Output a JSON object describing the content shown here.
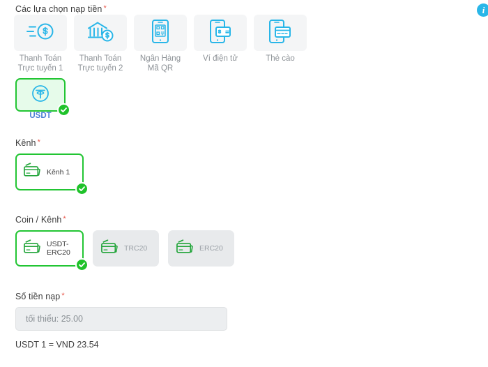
{
  "header": {
    "info_icon": "info-icon",
    "info_label": "i"
  },
  "deposit_options": {
    "heading": "Các lựa chọn nạp tiền",
    "required_mark": "*",
    "items": [
      {
        "label": "Thanh Toán\nTrực tuyến 1",
        "icon": "fast-money-coin-icon"
      },
      {
        "label": "Thanh Toán\nTrực tuyến 2",
        "icon": "bank-coin-icon"
      },
      {
        "label": "Ngân Hàng\nMã QR",
        "icon": "phone-qr-code-icon"
      },
      {
        "label": "Ví điện tử",
        "icon": "phone-wallet-icon"
      },
      {
        "label": "Thẻ cào",
        "icon": "phone-card-icon"
      }
    ]
  },
  "crypto_option": {
    "label": "USDT",
    "icon": "tether-coin-icon",
    "selected": true
  },
  "channel": {
    "heading": "Kênh",
    "required_mark": "*",
    "items": [
      {
        "label": "Kênh 1",
        "icon": "stacked-cards-icon",
        "selected": true
      }
    ]
  },
  "coin_channel": {
    "heading": "Coin / Kênh",
    "required_mark": "*",
    "items": [
      {
        "label": "USDT-\nERC20",
        "icon": "stacked-cards-icon",
        "selected": true
      },
      {
        "label": "TRC20",
        "icon": "stacked-cards-icon",
        "selected": false
      },
      {
        "label": "ERC20",
        "icon": "stacked-cards-icon",
        "selected": false
      }
    ]
  },
  "amount": {
    "heading": "Số tiền nạp",
    "required_mark": "*",
    "value": "",
    "placeholder": "tối thiểu: 25.00"
  },
  "exchange_rate": {
    "text": "USDT 1 = VND 23.54"
  },
  "colors": {
    "accent_green": "#22c533",
    "icon_blue": "#29b6e8",
    "required_red": "#e8564a",
    "label_gray": "#8c9196",
    "usdt_blue": "#4a7fd6"
  }
}
